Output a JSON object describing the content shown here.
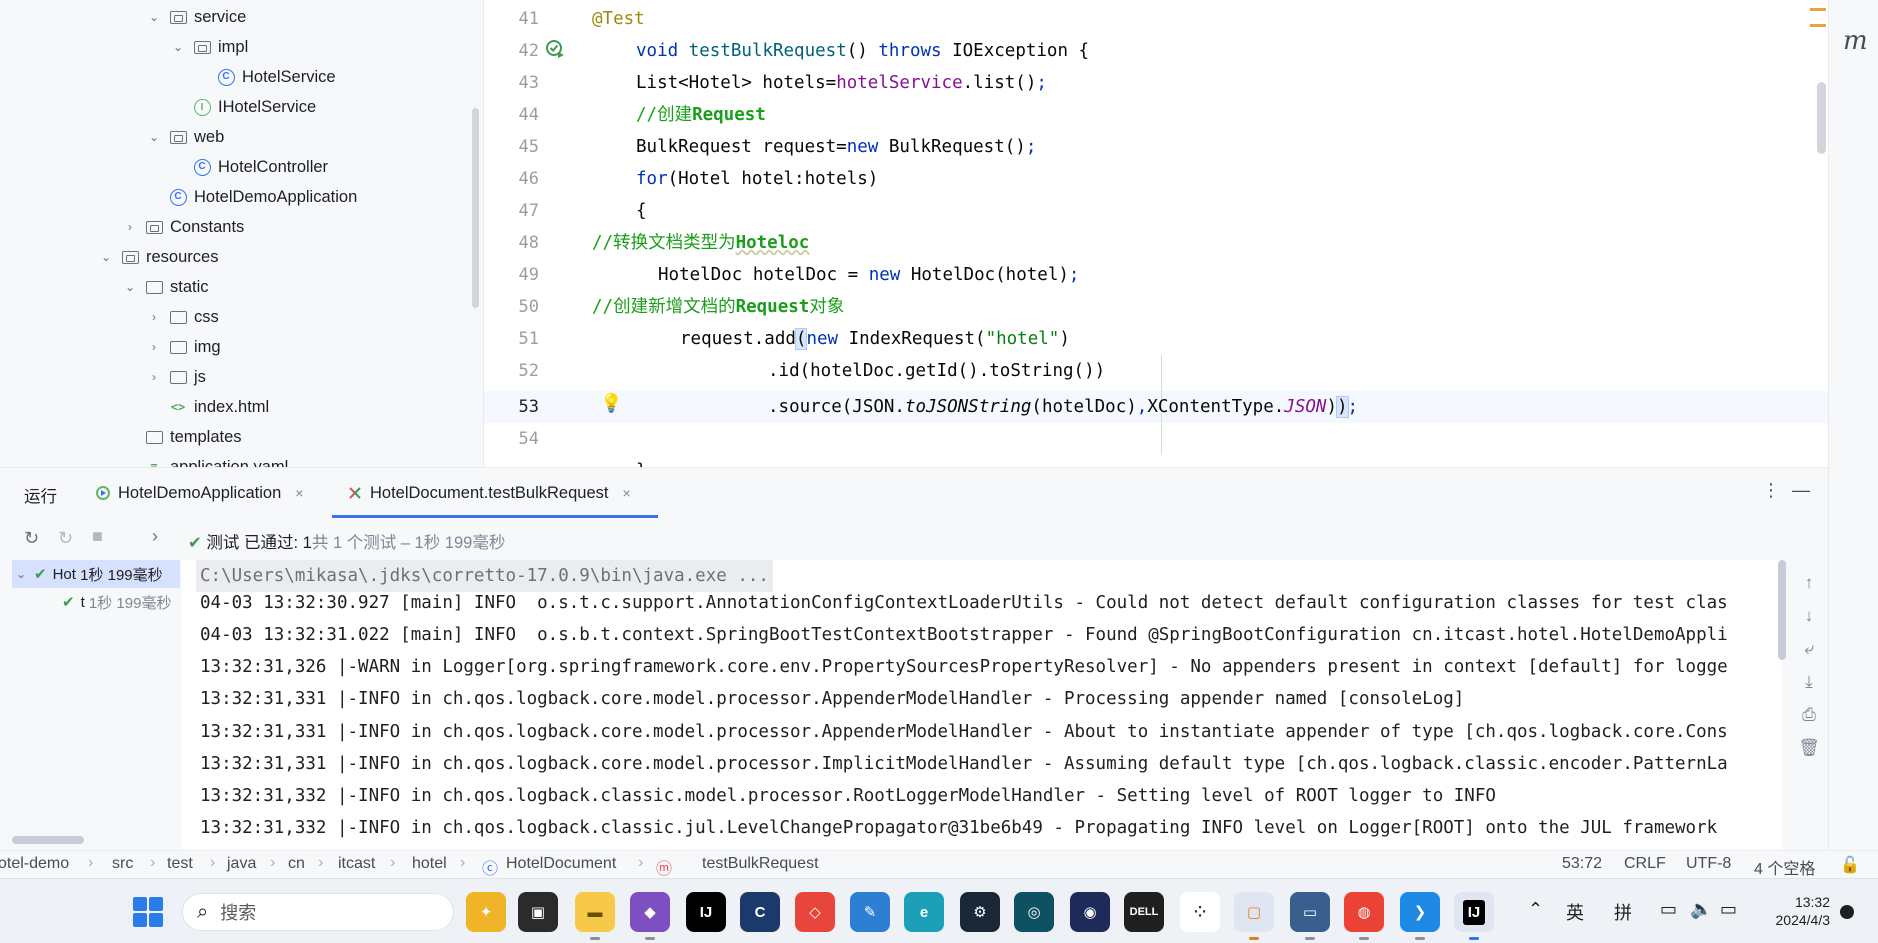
{
  "project_tree": {
    "items": [
      {
        "label": "service",
        "depth": 3,
        "chevron": "v",
        "icon": "package-folder-icon"
      },
      {
        "label": "impl",
        "depth": 4,
        "chevron": "v",
        "icon": "package-folder-icon"
      },
      {
        "label": "HotelService",
        "depth": 5,
        "chevron": "",
        "icon": "class-icon"
      },
      {
        "label": "IHotelService",
        "depth": 4,
        "chevron": "",
        "icon": "interface-icon"
      },
      {
        "label": "web",
        "depth": 3,
        "chevron": "v",
        "icon": "package-folder-icon"
      },
      {
        "label": "HotelController",
        "depth": 4,
        "chevron": "",
        "icon": "class-icon"
      },
      {
        "label": "HotelDemoApplication",
        "depth": 3,
        "chevron": "",
        "icon": "spring-class-icon"
      },
      {
        "label": "Constants",
        "depth": 2,
        "chevron": ">",
        "icon": "package-folder-icon"
      },
      {
        "label": "resources",
        "depth": 1,
        "chevron": "v",
        "icon": "resources-folder-icon"
      },
      {
        "label": "static",
        "depth": 2,
        "chevron": "v",
        "icon": "folder-icon"
      },
      {
        "label": "css",
        "depth": 3,
        "chevron": ">",
        "icon": "folder-icon"
      },
      {
        "label": "img",
        "depth": 3,
        "chevron": ">",
        "icon": "folder-icon"
      },
      {
        "label": "js",
        "depth": 3,
        "chevron": ">",
        "icon": "folder-icon"
      },
      {
        "label": "index.html",
        "depth": 3,
        "chevron": "",
        "icon": "html-file-icon"
      },
      {
        "label": "templates",
        "depth": 2,
        "chevron": "",
        "icon": "folder-icon"
      },
      {
        "label": "application.yaml",
        "depth": 2,
        "chevron": "",
        "icon": "yaml-file-icon"
      }
    ]
  },
  "editor": {
    "line_numbers": [
      "41",
      "42",
      "43",
      "44",
      "45",
      "46",
      "47",
      "48",
      "49",
      "50",
      "51",
      "52",
      "53",
      "54"
    ],
    "current_line": "53"
  },
  "run_panel": {
    "title": "运行",
    "tabs": [
      {
        "label": "HotelDemoApplication",
        "close": "×"
      },
      {
        "label": "HotelDocument.testBulkRequest",
        "close": "×"
      }
    ],
    "status_prefix": "测试 已通过: 1",
    "status_suffix": "共 1 个测试 – 1秒 199毫秒",
    "test_tree": [
      {
        "label": "Hot",
        "time": "1秒 199毫秒"
      },
      {
        "label": "t",
        "time": "1秒 199毫秒"
      }
    ],
    "console_lines": [
      "C:\\Users\\mikasa\\.jdks\\corretto-17.0.9\\bin\\java.exe ...",
      "04-03 13:32:30.927 [main] INFO  o.s.t.c.support.AnnotationConfigContextLoaderUtils - Could not detect default configuration classes for test clas",
      "04-03 13:32:31.022 [main] INFO  o.s.b.t.context.SpringBootTestContextBootstrapper - Found @SpringBootConfiguration cn.itcast.hotel.HotelDemoAppli",
      "13:32:31,326 |-WARN in Logger[org.springframework.core.env.PropertySourcesPropertyResolver] - No appenders present in context [default] for logge",
      "13:32:31,331 |-INFO in ch.qos.logback.core.model.processor.AppenderModelHandler - Processing appender named [consoleLog]",
      "13:32:31,331 |-INFO in ch.qos.logback.core.model.processor.AppenderModelHandler - About to instantiate appender of type [ch.qos.logback.core.Cons",
      "13:32:31,331 |-INFO in ch.qos.logback.core.model.processor.ImplicitModelHandler - Assuming default type [ch.qos.logback.classic.encoder.PatternLa",
      "13:32:31,332 |-INFO in ch.qos.logback.classic.model.processor.RootLoggerModelHandler - Setting level of ROOT logger to INFO",
      "13:32:31,332 |-INFO in ch.qos.logback.classic.jul.LevelChangePropagator@31be6b49 - Propagating INFO level on Logger[ROOT] onto the JUL framework"
    ]
  },
  "statusbar": {
    "breadcrumbs": [
      "otel-demo",
      "src",
      "test",
      "java",
      "cn",
      "itcast",
      "hotel",
      "HotelDocument",
      "testBulkRequest"
    ],
    "position": "53:72",
    "line_ending": "CRLF",
    "encoding": "UTF-8",
    "indent": "4 个空格"
  },
  "taskbar": {
    "search_placeholder": "搜索",
    "tray_lang1": "英",
    "tray_lang2": "拼",
    "time": "13:32",
    "date": "2024/4/3"
  },
  "colors": {
    "accent": "#3574f0",
    "pass_green": "#3d9a50",
    "comment_green": "#1b9e1b"
  }
}
